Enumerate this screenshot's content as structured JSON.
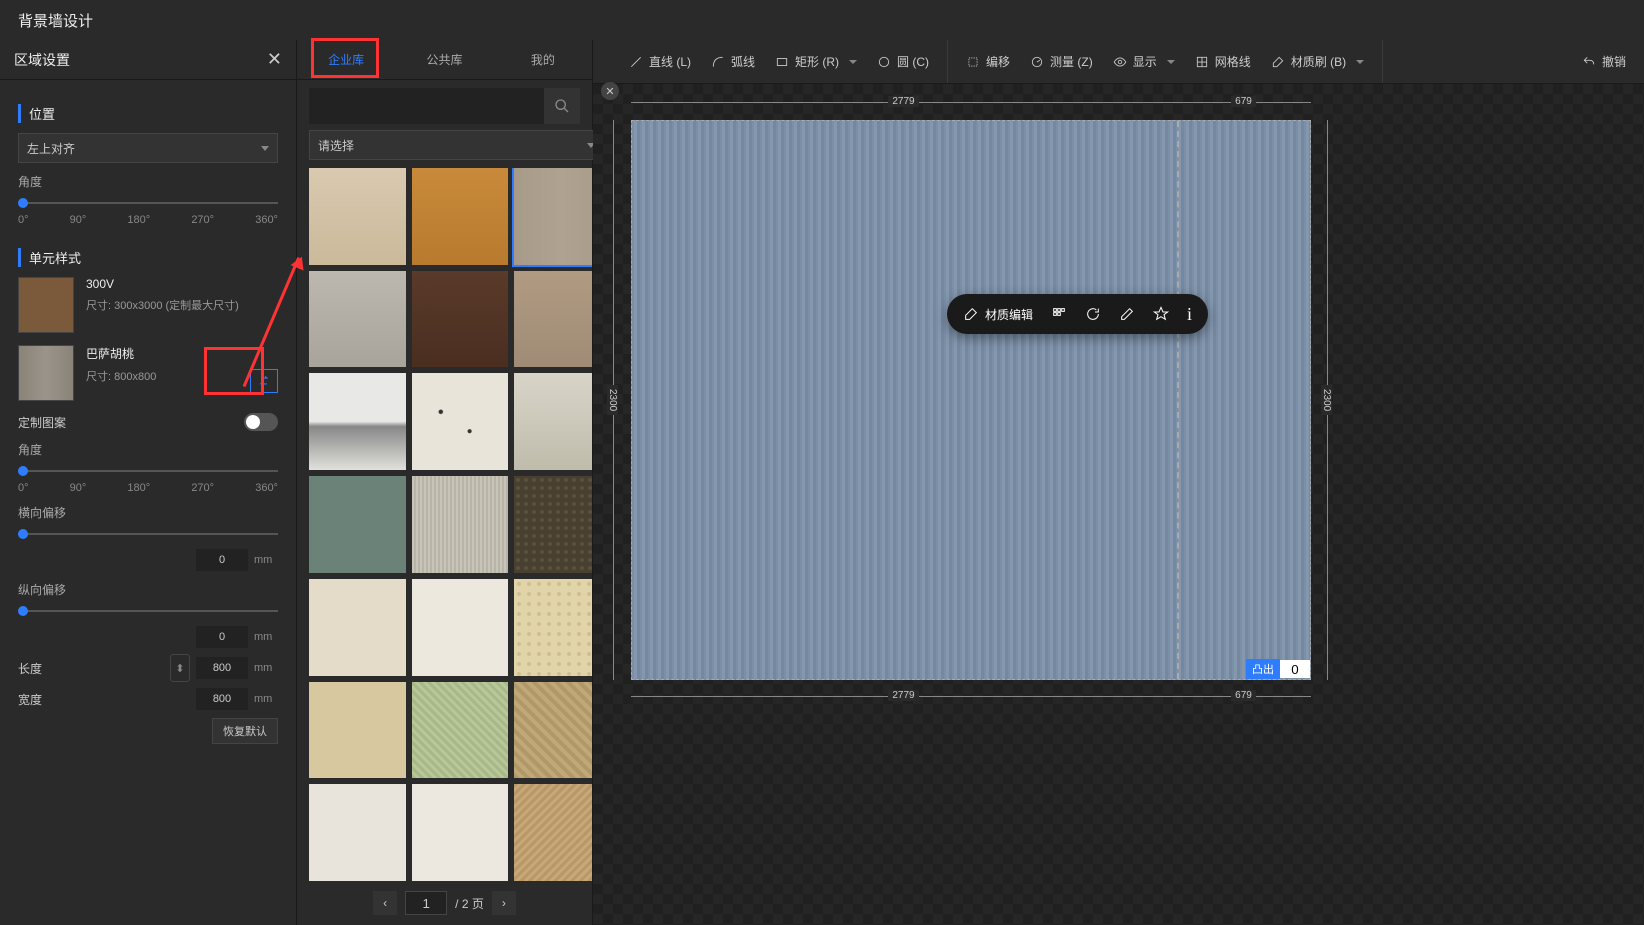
{
  "header": {
    "title": "背景墙设计"
  },
  "left": {
    "panel_title": "区域设置",
    "position_section": "位置",
    "align_select": "左上对齐",
    "angle_label": "角度",
    "angle_ticks": [
      "0°",
      "90°",
      "180°",
      "270°",
      "360°"
    ],
    "unit_section": "单元样式",
    "units": [
      {
        "name": "300V",
        "dim": "尺寸: 300x3000 (定制最大尺寸)"
      },
      {
        "name": "巴萨胡桃",
        "dim": "尺寸: 800x800"
      }
    ],
    "custom_pattern": "定制图案",
    "angle2_label": "角度",
    "h_offset": "横向偏移",
    "v_offset": "纵向偏移",
    "h_offset_val": "0",
    "v_offset_val": "0",
    "length_label": "长度",
    "width_label": "宽度",
    "length_val": "800",
    "width_val": "800",
    "mm": "mm",
    "restore": "恢复默认"
  },
  "mat": {
    "tabs": [
      "企业库",
      "公共库",
      "我的"
    ],
    "select_placeholder": "请选择",
    "page_current": "1",
    "page_total": "/ 2 页"
  },
  "toolbar": {
    "line": "直线 (L)",
    "arc": "弧线",
    "rect": "矩形 (R)",
    "circle": "圆 (C)",
    "edit": "编移",
    "measure": "测量 (Z)",
    "display": "显示",
    "grid": "网格线",
    "brush": "材质刷 (B)",
    "undo": "撤销"
  },
  "canvas": {
    "dim_w1": "2779",
    "dim_w2": "679",
    "dim_h": "2300",
    "float_edit": "材质编辑",
    "bulge_label": "凸出",
    "bulge_val": "0"
  }
}
